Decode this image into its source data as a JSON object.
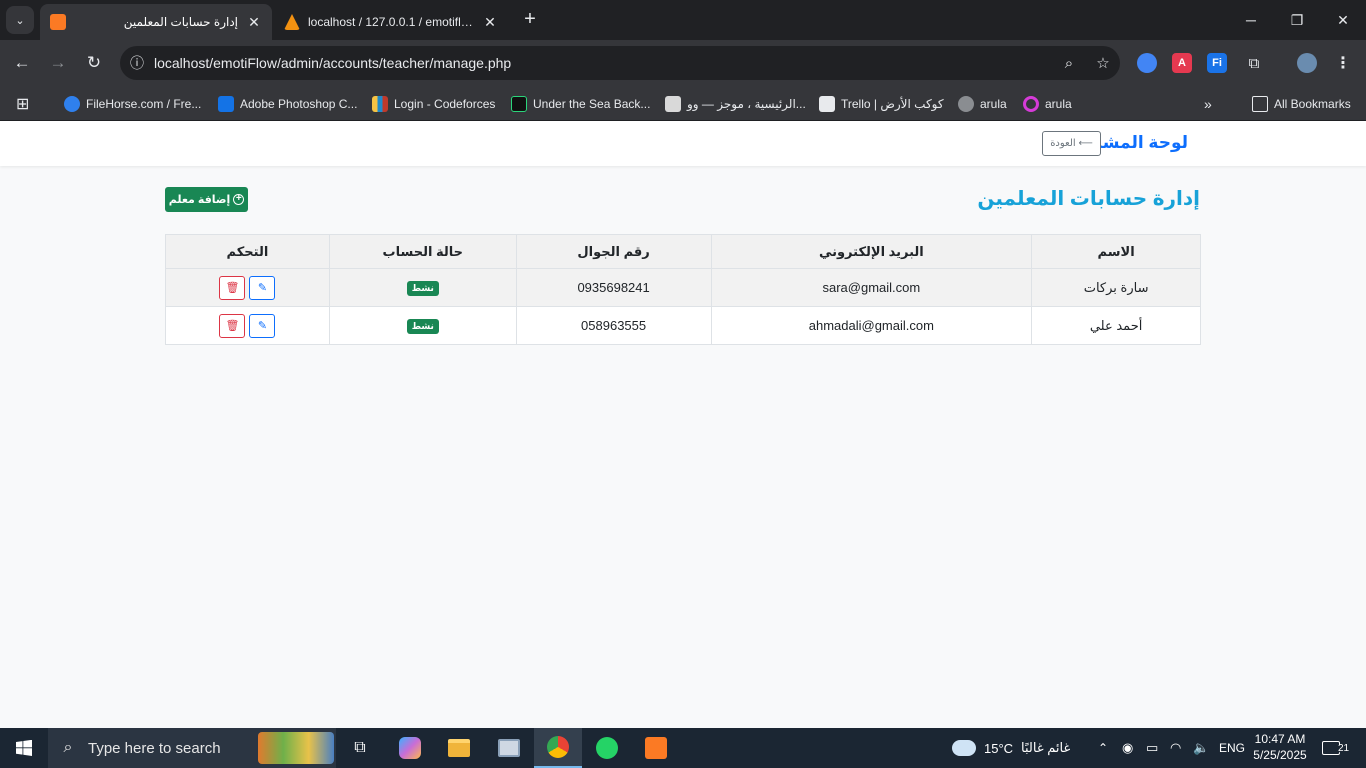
{
  "browser": {
    "tabs": [
      {
        "title": "إدارة حسابات المعلمين",
        "active": true
      },
      {
        "title": "localhost / 127.0.0.1 / emotiflow",
        "active": false
      }
    ],
    "url": "localhost/emotiFlow/admin/accounts/teacher/manage.php",
    "bookmarks": [
      {
        "label": "FileHorse.com / Fre..."
      },
      {
        "label": "Adobe Photoshop C..."
      },
      {
        "label": "Login - Codeforces"
      },
      {
        "label": "Under the Sea Back..."
      },
      {
        "label": "الرئيسية ، موجز — وو..."
      },
      {
        "label": "Trello | كوكب الأرض"
      },
      {
        "label": "arula"
      },
      {
        "label": "arula"
      }
    ],
    "all_bookmarks_label": "All Bookmarks"
  },
  "navbar": {
    "brand": "لوحة المشرف",
    "back_label": "⟵ العودة"
  },
  "main": {
    "title": "إدارة حسابات المعلمين",
    "add_button_label": "إضافة معلم",
    "table": {
      "headers": [
        "الاسم",
        "البريد الإلكتروني",
        "رقم الجوال",
        "حالة الحساب",
        "التحكم"
      ],
      "rows": [
        {
          "name": "سارة بركات",
          "email": "sara@gmail.com",
          "phone": "0935698241",
          "status": "نشط"
        },
        {
          "name": "أحمد علي",
          "email": "ahmadali@gmail.com",
          "phone": "058963555",
          "status": "نشط"
        }
      ]
    }
  },
  "taskbar": {
    "search_placeholder": "Type here to search",
    "weather_temp": "15°C",
    "weather_text": "غائم غالبًا",
    "lang": "ENG",
    "time": "10:47 AM",
    "date": "5/25/2025",
    "notifications": "21"
  }
}
